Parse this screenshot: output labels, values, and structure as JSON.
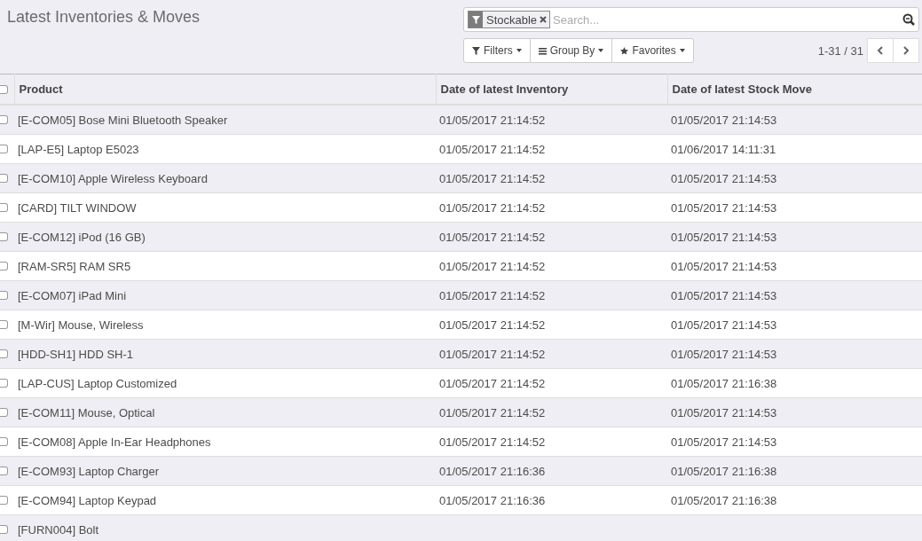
{
  "title": "Latest Inventories & Moves",
  "search": {
    "facet": "Stockable",
    "placeholder": "Search..."
  },
  "toolbar": [
    "Filters",
    "Group By",
    "Favorites"
  ],
  "pager": "1-31 / 31",
  "table": {
    "select_all": {
      "checked": false
    },
    "columns": [
      "Product",
      "Date of latest Inventory",
      "Date of latest Stock Move"
    ],
    "rows": [
      {
        "checked": false,
        "cells": [
          "[E-COM05] Bose Mini Bluetooth Speaker",
          "01/05/2017 21:14:52",
          "01/05/2017 21:14:53"
        ]
      },
      {
        "checked": false,
        "cells": [
          "[LAP-E5] Laptop E5023",
          "01/05/2017 21:14:52",
          "01/06/2017 14:11:31"
        ]
      },
      {
        "checked": false,
        "cells": [
          "[E-COM10] Apple Wireless Keyboard",
          "01/05/2017 21:14:52",
          "01/05/2017 21:14:53"
        ]
      },
      {
        "checked": false,
        "cells": [
          "[CARD] TILT WINDOW",
          "01/05/2017 21:14:52",
          "01/05/2017 21:14:53"
        ]
      },
      {
        "checked": false,
        "cells": [
          "[E-COM12] iPod (16 GB)",
          "01/05/2017 21:14:52",
          "01/05/2017 21:14:53"
        ]
      },
      {
        "checked": false,
        "cells": [
          "[RAM-SR5] RAM SR5",
          "01/05/2017 21:14:52",
          "01/05/2017 21:14:53"
        ]
      },
      {
        "checked": false,
        "cells": [
          "[E-COM07] iPad Mini",
          "01/05/2017 21:14:52",
          "01/05/2017 21:14:53"
        ]
      },
      {
        "checked": false,
        "cells": [
          "[M-Wir] Mouse, Wireless",
          "01/05/2017 21:14:52",
          "01/05/2017 21:14:53"
        ]
      },
      {
        "checked": false,
        "cells": [
          "[HDD-SH1] HDD SH-1",
          "01/05/2017 21:14:52",
          "01/05/2017 21:14:53"
        ]
      },
      {
        "checked": false,
        "cells": [
          "[LAP-CUS] Laptop Customized",
          "01/05/2017 21:14:52",
          "01/05/2017 21:16:38"
        ]
      },
      {
        "checked": false,
        "cells": [
          "[E-COM11] Mouse, Optical",
          "01/05/2017 21:14:52",
          "01/05/2017 21:14:53"
        ]
      },
      {
        "checked": false,
        "cells": [
          "[E-COM08] Apple In-Ear Headphones",
          "01/05/2017 21:14:52",
          "01/05/2017 21:14:53"
        ]
      },
      {
        "checked": false,
        "cells": [
          "[E-COM93] Laptop Charger",
          "01/05/2017 21:16:36",
          "01/05/2017 21:16:38"
        ]
      },
      {
        "checked": false,
        "cells": [
          "[E-COM94] Laptop Keypad",
          "01/05/2017 21:16:36",
          "01/05/2017 21:16:38"
        ]
      },
      {
        "checked": false,
        "cells": [
          "[FURN004] Bolt"
        ]
      }
    ]
  }
}
